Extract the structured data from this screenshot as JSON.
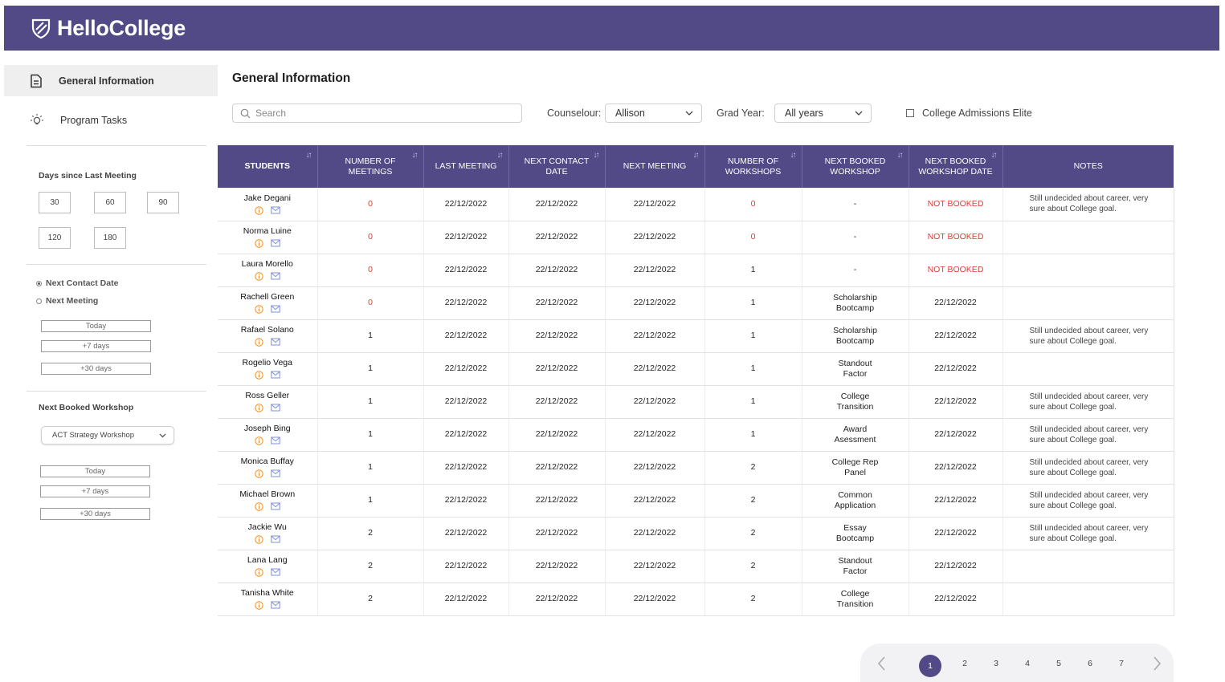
{
  "app": {
    "name": "HelloCollege"
  },
  "colors": {
    "brand": "#514a86",
    "danger": "#e53a2f"
  },
  "sidebar": {
    "nav": [
      {
        "label": "General Information",
        "icon": "document-icon",
        "active": true
      },
      {
        "label": "Program Tasks",
        "icon": "lightbulb-icon",
        "active": false
      }
    ],
    "days_label": "Days since Last Meeting",
    "days": [
      "30",
      "60",
      "90",
      "120",
      "180"
    ],
    "radio_options": [
      {
        "label": "Next Contact Date",
        "checked": true
      },
      {
        "label": "Next Meeting",
        "checked": false
      }
    ],
    "ranges_1": [
      "Today",
      "+7 days",
      "+30 days"
    ],
    "workshop_label": "Next Booked Workshop",
    "workshop_selected": "ACT Strategy Workshop",
    "ranges_2": [
      "Today",
      "+7 days",
      "+30 days"
    ]
  },
  "main": {
    "title": "General Information",
    "search_placeholder": "Search",
    "counselor_label": "Counselour:",
    "counselor_value": "Allison",
    "grad_label": "Grad Year:",
    "grad_value": "All years",
    "elite_label": "College Admissions Elite",
    "elite_checked": false
  },
  "table": {
    "headers": [
      "STUDENTS",
      "NUMBER OF MEETINGS",
      "LAST MEETING",
      "NEXT CONTACT DATE",
      "NEXT MEETING",
      "NUMBER OF WORKSHOPS",
      "NEXT BOOKED WORKSHOP",
      "NEXT BOOKED WORKSHOP DATE",
      "NOTES"
    ],
    "rows": [
      {
        "name": "Jake Degani",
        "meetings": "0",
        "last": "22/12/2022",
        "contact": "22/12/2022",
        "next": "22/12/2022",
        "workshops": "0",
        "workshop": "-",
        "wdate": "NOT BOOKED",
        "notes": "Still undecided about career, very sure about College goal."
      },
      {
        "name": "Norma Luine",
        "meetings": "0",
        "last": "22/12/2022",
        "contact": "22/12/2022",
        "next": "22/12/2022",
        "workshops": "0",
        "workshop": "-",
        "wdate": "NOT BOOKED",
        "notes": ""
      },
      {
        "name": "Laura Morello",
        "meetings": "0",
        "last": "22/12/2022",
        "contact": "22/12/2022",
        "next": "22/12/2022",
        "workshops": "1",
        "workshop": "-",
        "wdate": "NOT BOOKED",
        "notes": ""
      },
      {
        "name": "Rachell Green",
        "meetings": "0",
        "last": "22/12/2022",
        "contact": "22/12/2022",
        "next": "22/12/2022",
        "workshops": "1",
        "workshop": "Scholarship Bootcamp",
        "wdate": "22/12/2022",
        "notes": ""
      },
      {
        "name": "Rafael Solano",
        "meetings": "1",
        "last": "22/12/2022",
        "contact": "22/12/2022",
        "next": "22/12/2022",
        "workshops": "1",
        "workshop": "Scholarship Bootcamp",
        "wdate": "22/12/2022",
        "notes": "Still undecided about career, very sure about College goal."
      },
      {
        "name": "Rogelio Vega",
        "meetings": "1",
        "last": "22/12/2022",
        "contact": "22/12/2022",
        "next": "22/12/2022",
        "workshops": "1",
        "workshop": "Standout Factor",
        "wdate": "22/12/2022",
        "notes": ""
      },
      {
        "name": "Ross Geller",
        "meetings": "1",
        "last": "22/12/2022",
        "contact": "22/12/2022",
        "next": "22/12/2022",
        "workshops": "1",
        "workshop": "College Transition",
        "wdate": "22/12/2022",
        "notes": "Still undecided about career, very sure about College goal."
      },
      {
        "name": "Joseph Bing",
        "meetings": "1",
        "last": "22/12/2022",
        "contact": "22/12/2022",
        "next": "22/12/2022",
        "workshops": "1",
        "workshop": "Award Asessment",
        "wdate": "22/12/2022",
        "notes": "Still undecided about career, very sure about College goal."
      },
      {
        "name": "Monica Buffay",
        "meetings": "1",
        "last": "22/12/2022",
        "contact": "22/12/2022",
        "next": "22/12/2022",
        "workshops": "2",
        "workshop": "College Rep Panel",
        "wdate": "22/12/2022",
        "notes": "Still undecided about career, very sure about College goal."
      },
      {
        "name": "Michael Brown",
        "meetings": "1",
        "last": "22/12/2022",
        "contact": "22/12/2022",
        "next": "22/12/2022",
        "workshops": "2",
        "workshop": "Common Application",
        "wdate": "22/12/2022",
        "notes": "Still undecided about career, very sure about College goal."
      },
      {
        "name": "Jackie Wu",
        "meetings": "2",
        "last": "22/12/2022",
        "contact": "22/12/2022",
        "next": "22/12/2022",
        "workshops": "2",
        "workshop": "Essay Bootcamp",
        "wdate": "22/12/2022",
        "notes": "Still undecided about career, very sure about College goal."
      },
      {
        "name": "Lana Lang",
        "meetings": "2",
        "last": "22/12/2022",
        "contact": "22/12/2022",
        "next": "22/12/2022",
        "workshops": "2",
        "workshop": "Standout Factor",
        "wdate": "22/12/2022",
        "notes": ""
      },
      {
        "name": "Tanisha White",
        "meetings": "2",
        "last": "22/12/2022",
        "contact": "22/12/2022",
        "next": "22/12/2022",
        "workshops": "2",
        "workshop": "College Transition",
        "wdate": "22/12/2022",
        "notes": ""
      }
    ]
  },
  "pagination": {
    "pages": [
      "1",
      "2",
      "3",
      "4",
      "5",
      "6",
      "7"
    ],
    "current": "1"
  }
}
